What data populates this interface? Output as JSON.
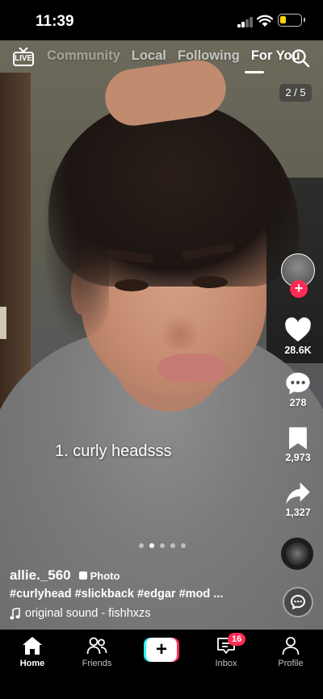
{
  "status_bar": {
    "time": "11:39",
    "battery_color": "#ffd60a",
    "icons": [
      "signal-icon",
      "wifi-icon",
      "battery-icon"
    ]
  },
  "top_nav": {
    "live_label": "LIVE",
    "tabs": [
      {
        "label": "Community",
        "active": false
      },
      {
        "label": "Local",
        "active": false
      },
      {
        "label": "Following",
        "active": false
      },
      {
        "label": "For You",
        "active": true
      }
    ],
    "search_icon": "search-icon"
  },
  "carousel": {
    "counter": "2 / 5",
    "dots_total": 5,
    "active_dot_index": 1
  },
  "overlay_caption": "1. curly headsss",
  "actions": {
    "likes": "28.6K",
    "comments": "278",
    "bookmarks": "2,973",
    "shares": "1,327"
  },
  "post": {
    "author": "allie._560",
    "type_badge": "Photo",
    "hashtags": "#curlyhead #slickback #edgar #mod ...",
    "sound": "original sound - fishhxzs"
  },
  "bottom_nav": {
    "items": [
      {
        "label": "Home",
        "icon": "home-icon",
        "active": true
      },
      {
        "label": "Friends",
        "icon": "friends-icon",
        "active": false
      },
      {
        "label": "Inbox",
        "icon": "inbox-icon",
        "active": false,
        "badge": "16"
      },
      {
        "label": "Profile",
        "icon": "profile-icon",
        "active": false
      }
    ],
    "create_icon": "plus-icon"
  },
  "colors": {
    "accent": "#fe2c55",
    "cyan": "#25f4ee",
    "background": "#000000"
  }
}
